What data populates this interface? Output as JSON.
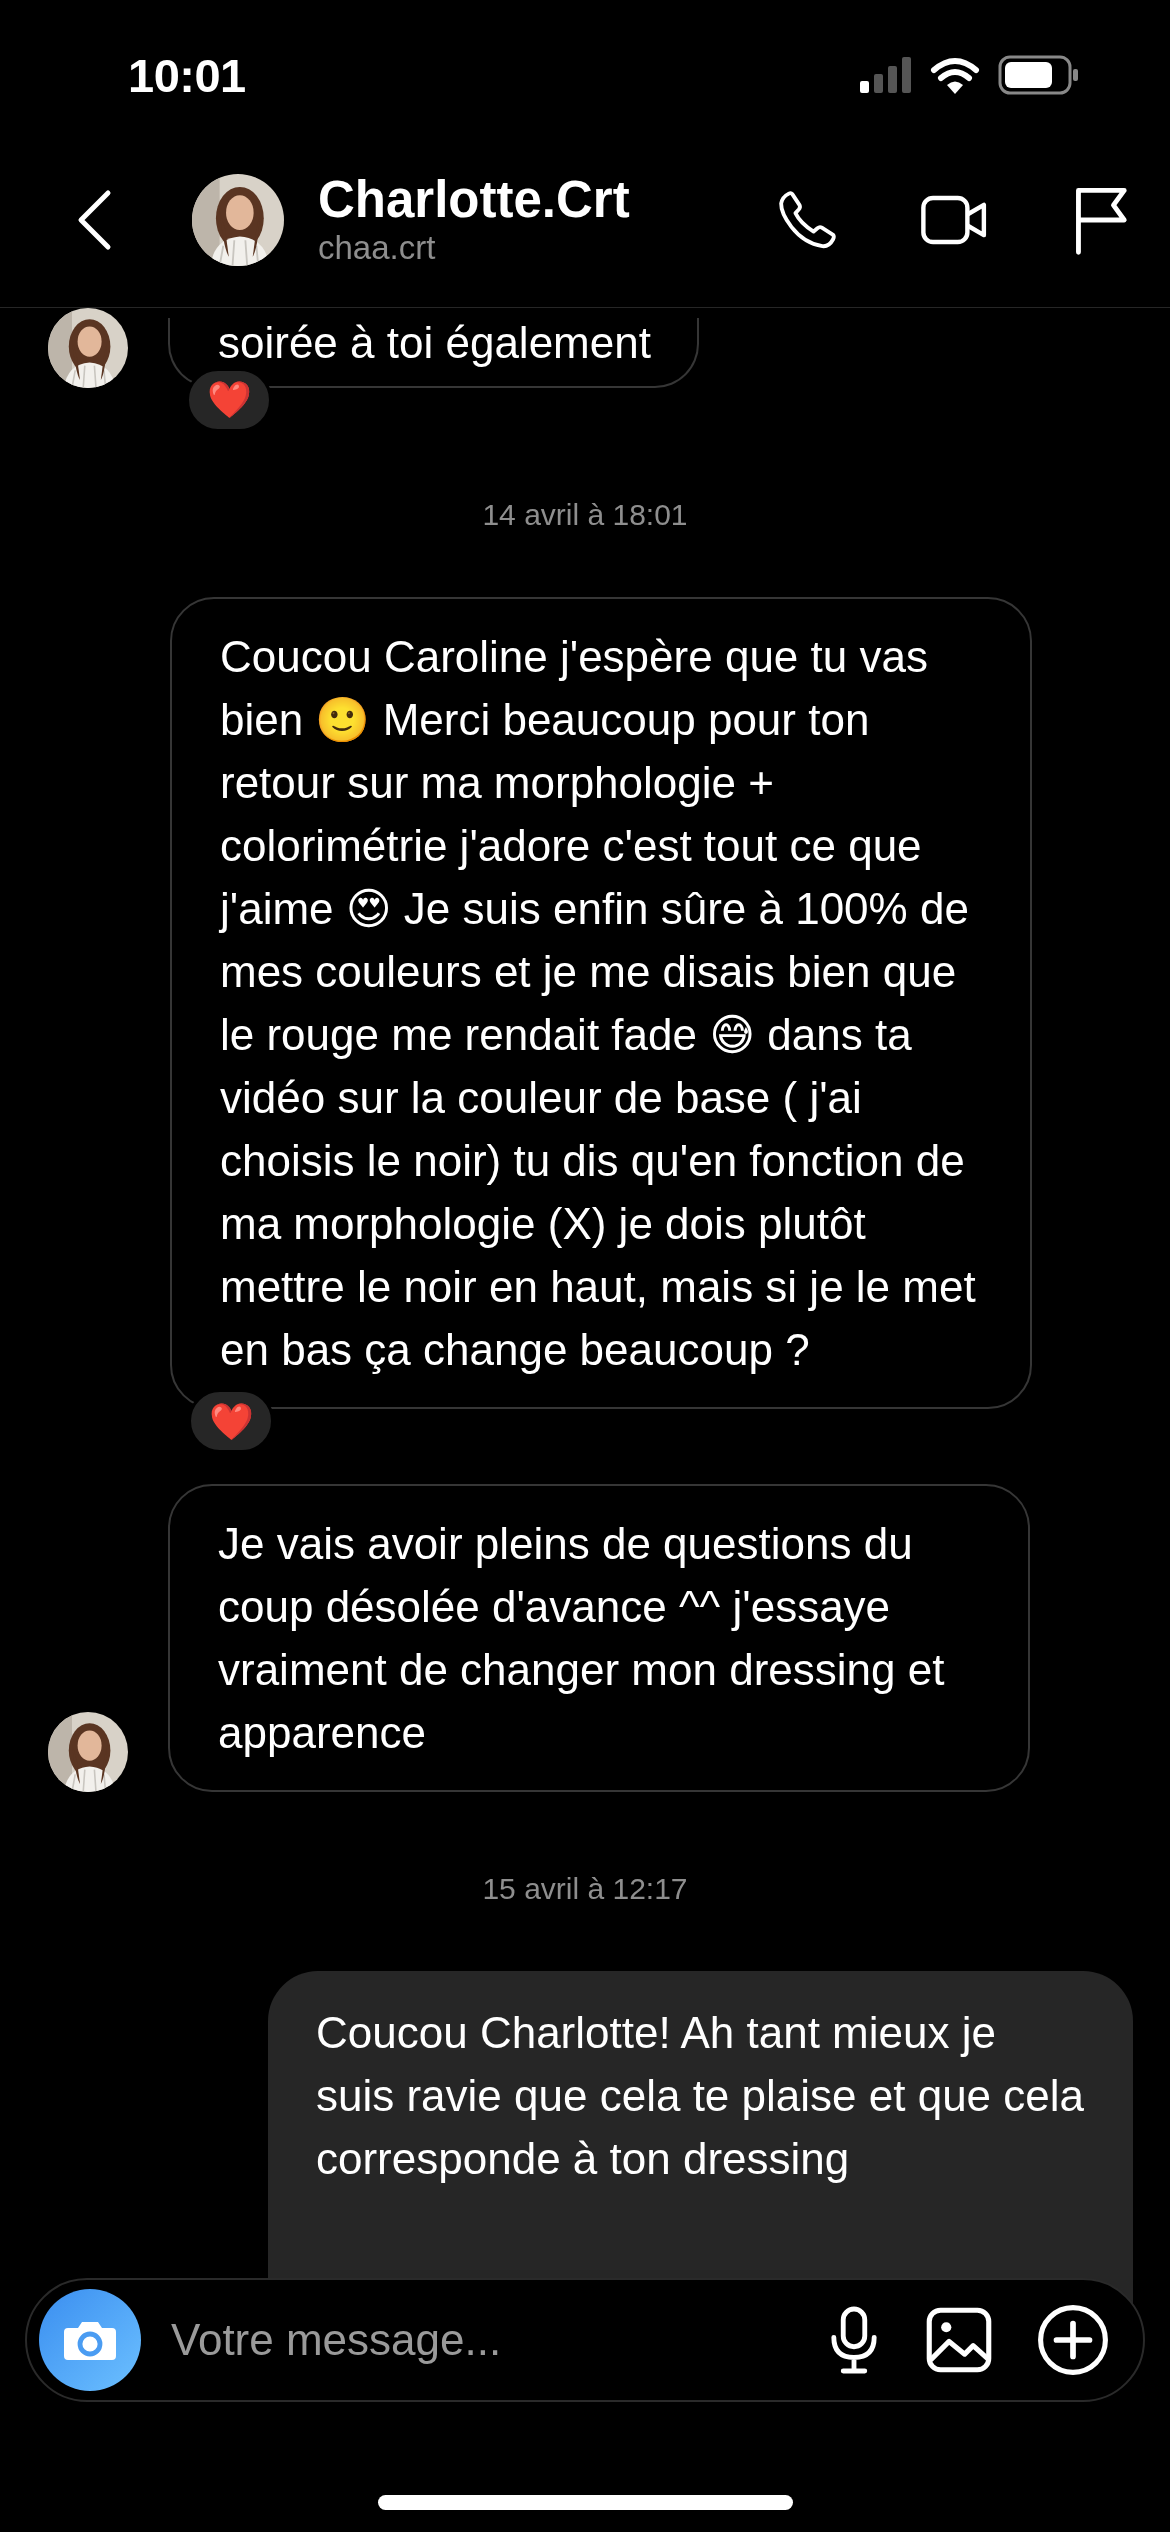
{
  "status_bar": {
    "time": "10:01"
  },
  "header": {
    "name": "Charlotte.Crt",
    "username": "chaa.crt"
  },
  "messages": [
    {
      "kind": "incoming",
      "text": "soirée à toi également",
      "reaction": "❤️",
      "avatar": true
    },
    {
      "kind": "timestamp",
      "text": "14 avril à 18:01"
    },
    {
      "kind": "incoming",
      "text": "Coucou Caroline j'espère que tu vas bien 🙂 Merci beaucoup pour ton retour sur ma morphologie + colorimétrie j'adore c'est tout ce que j'aime 😍 Je suis enfin sûre à 100% de mes couleurs et je me disais bien que le rouge me rendait fade 😅 dans ta vidéo sur la couleur de base ( j'ai choisis le noir) tu dis qu'en fonction de ma morphologie (X) je dois plutôt mettre le noir en haut, mais si je le met en bas ça change beaucoup ?",
      "reaction": "❤️",
      "avatar": false
    },
    {
      "kind": "incoming",
      "text": "Je vais avoir pleins de questions du coup désolée d'avance ^^ j'essaye vraiment de changer mon dressing et apparence",
      "avatar": true
    },
    {
      "kind": "timestamp",
      "text": "15 avril à 12:17"
    },
    {
      "kind": "outgoing",
      "text": "Coucou Charlotte! Ah tant mieux je suis ravie que cela te plaise et que cela corresponde à ton dressing"
    }
  ],
  "composer": {
    "placeholder": "Votre message..."
  }
}
